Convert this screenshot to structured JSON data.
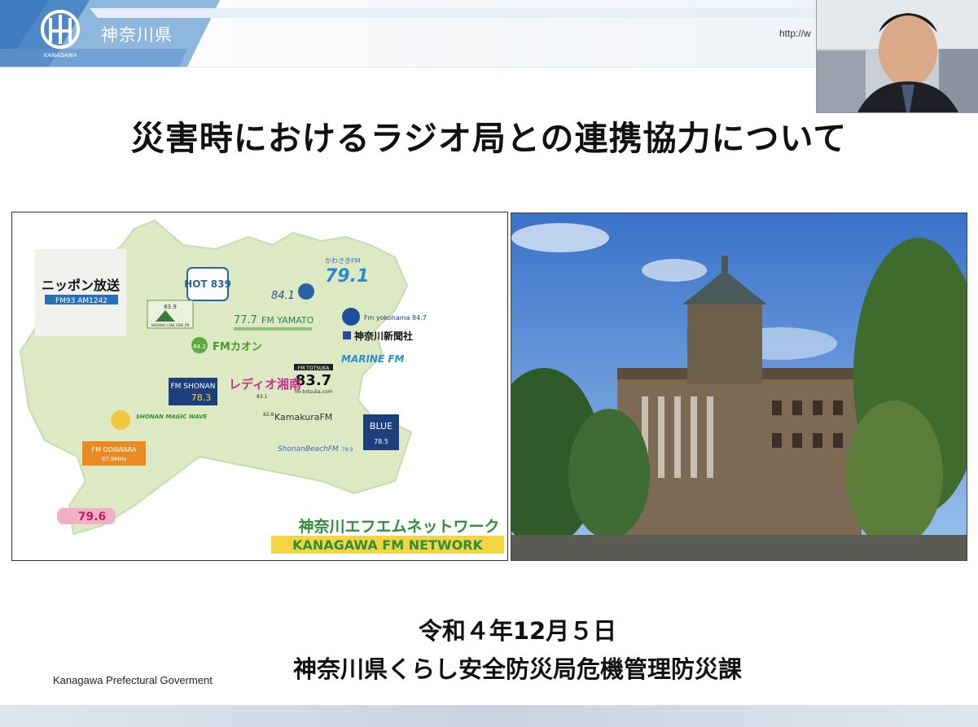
{
  "header": {
    "prefecture_name": "神奈川県",
    "logo_caption": "KANAGAWA",
    "url": "http://w"
  },
  "slide": {
    "title": "災害時におけるラジオ局との連携協力について",
    "date": "令和４年12月５日",
    "department": "神奈川県くらし安全防災局危機管理防災課",
    "footer_org": "Kanagawa Prefectural Goverment"
  },
  "map": {
    "network_name_jp": "神奈川エフエムネットワーク",
    "network_name_en": "KANAGAWA FM NETWORK",
    "stations": {
      "nippon_housou": "ニッポン放送",
      "nippon_freq": "FM93  AM1242",
      "fm_hot": "HOT 839",
      "fm_841": "84.1",
      "kawasaki": "かわさきFM",
      "kawasaki_freq": "79.1",
      "hadano": "HADANO LAKE SIDE FM",
      "hadano_freq": "83.9",
      "yamato": "FM YAMATO",
      "yamato_freq": "77.7",
      "fm_yokohama": "Fm yokohama 84.7",
      "kanagawa_shimbun": "神奈川新聞社",
      "marine": "MARINE FM",
      "fm_kaon": "FMカオン",
      "fm_kaon_freq": "84.2",
      "totsuka": "FM TOTSUKA",
      "totsuka_freq": "83.7",
      "totsuka_url": "fm-totsuka.com",
      "shonan": "FM SHONAN",
      "shonan_freq": "78.3",
      "radio_shonan": "レディオ湘南",
      "radio_shonan_freq": "83.1",
      "kamakura": "KamakuraFM",
      "kamakura_freq": "82.8",
      "blue": "BLUE",
      "blue_freq": "78.5",
      "magic_wave": "SHONAN MAGIC WAVE",
      "shonan_beach": "ShonanBeachFM",
      "shonan_beach_freq": "78.9",
      "odawara": "FM ODAWARA",
      "odawara_freq": "87.9MHz",
      "yokosuka_freq": "79.6"
    }
  },
  "webcam": {
    "label": "presenter-video"
  }
}
